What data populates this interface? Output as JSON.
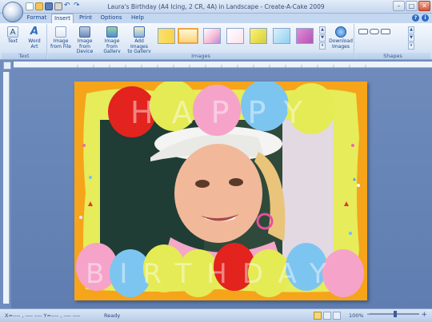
{
  "window": {
    "title": "Laura's Birthday (A4 Icing, 2 CR, 4A) in Landscape - Create-A-Cake 2009"
  },
  "tabs": [
    {
      "label": "Format"
    },
    {
      "label": "Insert"
    },
    {
      "label": "Print"
    },
    {
      "label": "Options"
    },
    {
      "label": "Help"
    }
  ],
  "ribbon": {
    "groups": {
      "text": "Text",
      "images": "Images",
      "shapes": "Shapes"
    },
    "buttons": {
      "text": "Text",
      "word_art": "Word\nArt",
      "image_from_file": "Image\nfrom File",
      "image_from_device": "Image from\nDevice",
      "image_from_gallery": "Image from\nGallery",
      "add_images_to_gallery": "Add Images\nto Gallery",
      "download_images": "Download\nImages"
    }
  },
  "statusbar": {
    "left1": "X=---- , ---- ---- Y=---- , ---- ----",
    "ready": "Ready",
    "zoom": "100%"
  },
  "canvas": {
    "banner_top": "HAPPY",
    "banner_bottom": "BIRTHDAY"
  },
  "colors": {
    "ribbon_text": "#15428b",
    "card_bg": "#f6a41a",
    "frame_yellow": "#e6ec5a"
  }
}
